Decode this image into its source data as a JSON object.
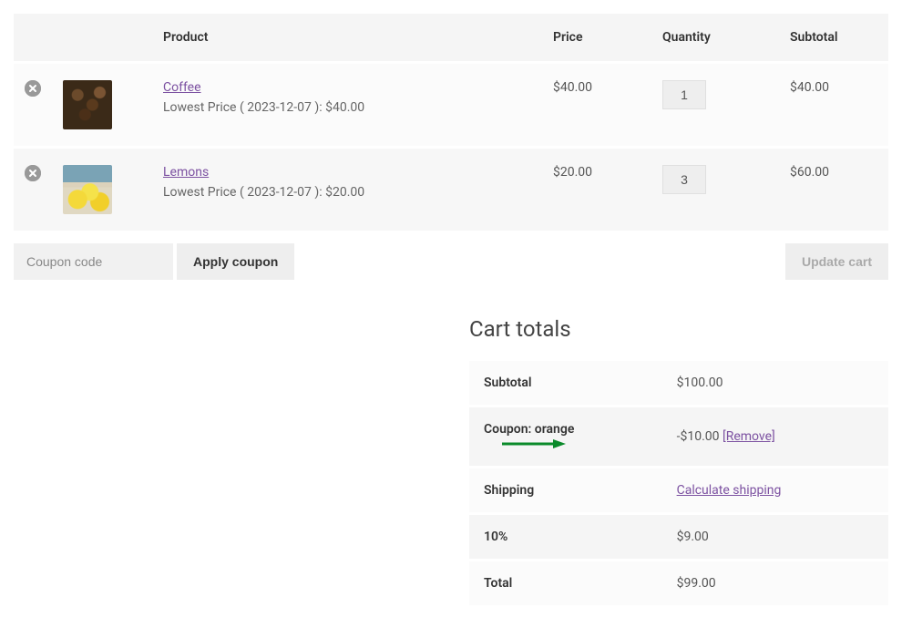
{
  "table": {
    "headers": {
      "product": "Product",
      "price": "Price",
      "quantity": "Quantity",
      "subtotal": "Subtotal"
    },
    "rows": [
      {
        "remove_icon": "remove",
        "thumb": "coffee",
        "name": "Coffee",
        "lowest_price_text": "Lowest Price ( 2023-12-07 ): $40.00",
        "price": "$40.00",
        "qty": "1",
        "subtotal": "$40.00"
      },
      {
        "remove_icon": "remove",
        "thumb": "lemons",
        "name": "Lemons",
        "lowest_price_text": "Lowest Price ( 2023-12-07 ): $20.00",
        "price": "$20.00",
        "qty": "3",
        "subtotal": "$60.00"
      }
    ]
  },
  "actions": {
    "coupon_placeholder": "Coupon code",
    "apply_label": "Apply coupon",
    "update_label": "Update cart"
  },
  "totals": {
    "heading": "Cart totals",
    "subtotal_label": "Subtotal",
    "subtotal_value": "$100.00",
    "coupon_label": "Coupon: orange",
    "coupon_value": "-$10.00",
    "remove_link": "[Remove]",
    "shipping_label": "Shipping",
    "calculate_link": "Calculate shipping",
    "tax_label": "10%",
    "tax_value": "$9.00",
    "total_label": "Total",
    "total_value": "$99.00"
  },
  "colors": {
    "link": "#7c51a1",
    "arrow": "#0a8a2a"
  }
}
